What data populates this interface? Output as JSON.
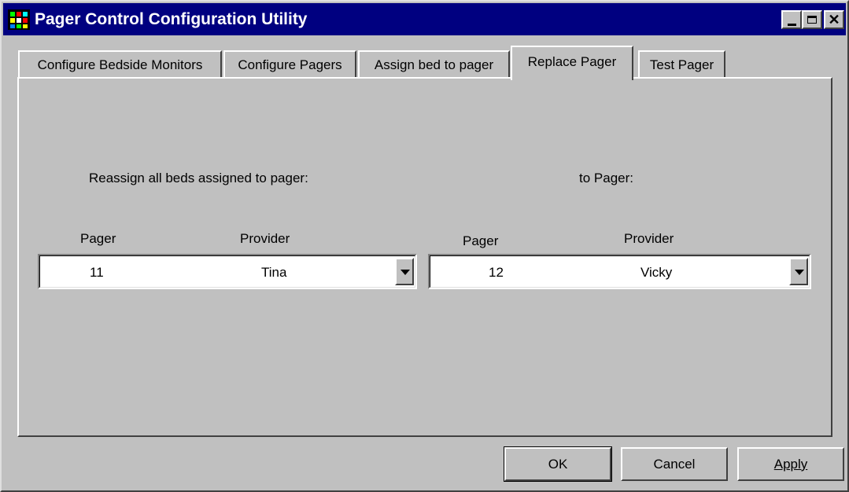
{
  "window": {
    "title": "Pager Control Configuration Utility"
  },
  "caption_buttons": {
    "close": "✕"
  },
  "tabs": [
    {
      "label": "Configure Bedside Monitors",
      "active": false
    },
    {
      "label": "Configure Pagers",
      "active": false
    },
    {
      "label": "Assign bed to pager",
      "active": false
    },
    {
      "label": "Replace Pager",
      "active": true
    },
    {
      "label": "Test Pager",
      "active": false
    }
  ],
  "replace": {
    "from_heading": "Reassign all beds assigned to pager:",
    "to_heading": "to Pager:",
    "from": {
      "pager_label": "Pager",
      "provider_label": "Provider",
      "pager": "11",
      "provider": "Tina"
    },
    "to": {
      "pager_label": "Pager",
      "provider_label": "Provider",
      "pager": "12",
      "provider": "Vicky"
    }
  },
  "buttons": {
    "ok": "OK",
    "cancel": "Cancel",
    "apply": "Apply"
  },
  "colors": {
    "face": "#c0c0c0",
    "title_bar": "#000080",
    "title_text": "#ffffff"
  },
  "icons": [
    "app-icon",
    "minimize-icon",
    "maximize-icon",
    "close-icon",
    "dropdown-arrow-icon"
  ]
}
